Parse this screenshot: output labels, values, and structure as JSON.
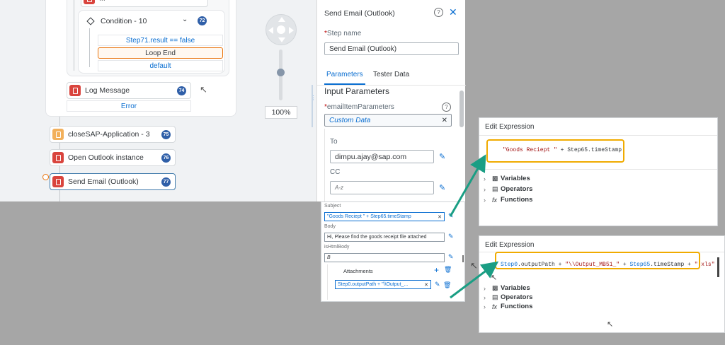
{
  "canvas": {
    "truncated_node_label": "...",
    "condition": {
      "label": "Condition - 10",
      "badge": "72"
    },
    "branches": {
      "step71": "Step71.result == false",
      "loop_end": "Loop End",
      "default": "default"
    },
    "log_message": {
      "label": "Log Message",
      "badge": "74"
    },
    "error_link": "Error",
    "nodes": [
      {
        "label": "closeSAP-Application - 3",
        "badge": "75",
        "color": "orange"
      },
      {
        "label": "Open Outlook instance",
        "badge": "76",
        "color": "red"
      },
      {
        "label": "Send Email (Outlook)",
        "badge": "77",
        "color": "red"
      }
    ],
    "zoom": "100%",
    "zoom_level": 0.55
  },
  "panel": {
    "title": "Send Email (Outlook)",
    "step_name_label": "Step name",
    "step_name_value": "Send Email (Outlook)",
    "tabs": [
      "Parameters",
      "Tester Data"
    ],
    "section_title": "Input Parameters",
    "param_label": "emailItemParameters",
    "param_value": "Custom Data",
    "to_label": "To",
    "to_value": "dimpu.ajay@sap.com",
    "cc_label": "CC",
    "cc_value": "A-z"
  },
  "lower": {
    "subject_label": "Subject",
    "subject_value": "\"Goods Reciept \" + Step65.timeStamp",
    "body_label": "Body",
    "body_value": "Hi, Please find the goods receipt file attached",
    "ishtml_label": "isHtmlBody",
    "ishtml_value": "B",
    "attachments_label": "Attachments",
    "attachment_value": "Step0.outputPath + \"\\\\Output_..."
  },
  "dialog1": {
    "title": "Edit Expression",
    "expression_string": "\"Goods Reciept \"",
    "expression_rest": " + Step65.timeStamp",
    "tree": [
      "Variables",
      "Operators",
      "Functions"
    ]
  },
  "dialog2": {
    "title": "Edit Expression",
    "expr_part1": "Step0",
    "expr_part2": ".outputPath + ",
    "expr_part3": "\"\\\\Output_MB51_\"",
    "expr_part4": " + ",
    "expr_part5": "Step65",
    "expr_part6": ".timeStamp + ",
    "expr_part7": "\".xls\"",
    "tree": [
      "Variables",
      "Operators",
      "Functions"
    ]
  },
  "colors": {
    "accent": "#0a6ed1",
    "badge": "#2f5fa8",
    "highlight": "#f0ab00",
    "arrow": "#1a9e84",
    "error_icon": "#d9443d"
  }
}
